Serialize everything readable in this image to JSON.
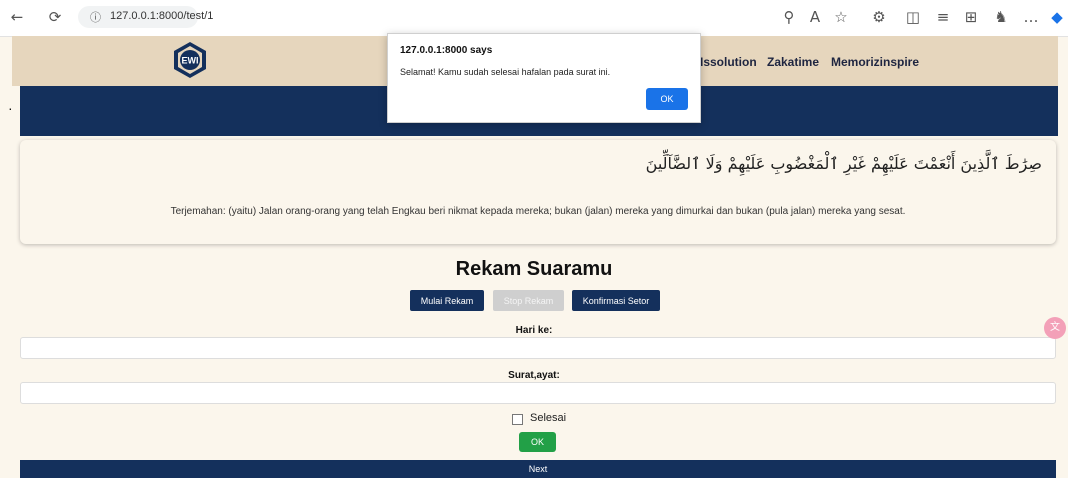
{
  "browser": {
    "url": "127.0.0.1:8000/test/1",
    "icons": [
      "back-arrow-icon",
      "refresh-icon",
      "info-icon",
      "zoom-icon",
      "read-aloud-icon",
      "favorite-star-icon",
      "extensions-icon",
      "split-screen-icon",
      "favorites-icon",
      "collections-icon",
      "profile-icon",
      "more-icon",
      "copilot-icon"
    ]
  },
  "navbar": {
    "logo_text": "EWI",
    "links": [
      "Issolution",
      "Zakatime",
      "Memorizinspire"
    ]
  },
  "ayah": {
    "arabic": "صِرَٰطَ ٱلَّذِينَ أَنْعَمْتَ عَلَيْهِمْ غَيْرِ ٱلْمَغْضُوبِ عَلَيْهِمْ وَلَا ٱلضَّآلِّينَ",
    "translation": "Terjemahan: (yaitu) Jalan orang-orang yang telah Engkau beri nikmat kepada mereka; bukan (jalan) mereka yang dimurkai dan bukan (pula jalan) mereka yang sesat."
  },
  "recorder": {
    "title": "Rekam Suaramu",
    "start_label": "Mulai Rekam",
    "stop_label": "Stop Rekam",
    "confirm_label": "Konfirmasi Setor",
    "day_label": "Hari ke:",
    "day_value": "",
    "surah_label": "Surat,ayat:",
    "surah_value": "",
    "done_label": "Selesai",
    "done_checked": false,
    "ok_label": "OK",
    "next_label": "Next"
  },
  "dialog": {
    "title": "127.0.0.1:8000 says",
    "message": "Selamat! Kamu sudah selesai hafalan pada surat ini.",
    "ok_label": "OK"
  },
  "colors": {
    "navy": "#14305c",
    "beige": "#e6d6bd",
    "cream": "#fbf6ec",
    "green": "#22a047",
    "dialog_blue": "#1a73e8",
    "disabled_gray": "#cfcfcf"
  }
}
